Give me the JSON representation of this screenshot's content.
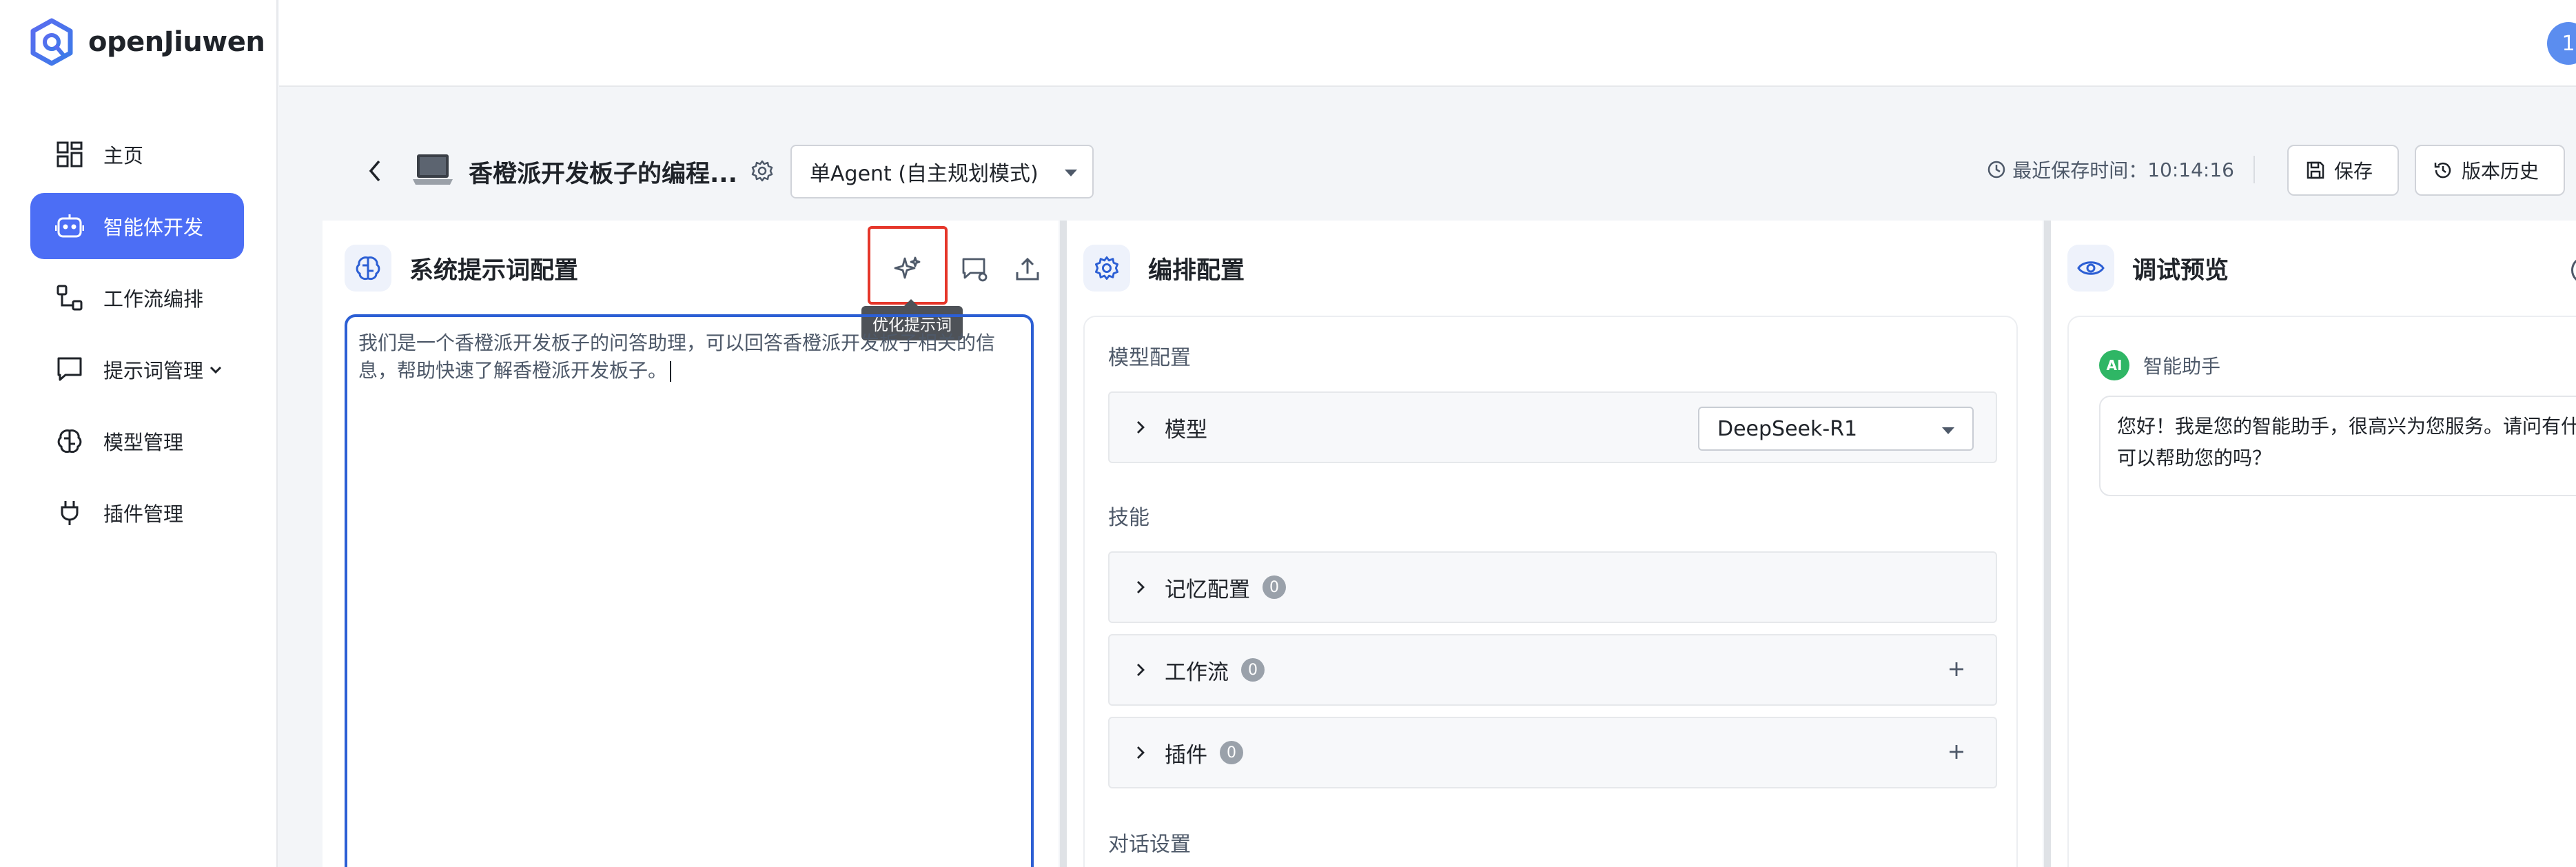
{
  "brand": {
    "name": "openJiuwen",
    "accent": "#4c6ef5"
  },
  "sidebar": {
    "items": [
      {
        "label": "主页",
        "icon": "grid-icon",
        "active": false
      },
      {
        "label": "智能体开发",
        "icon": "robot-icon",
        "active": true
      },
      {
        "label": "工作流编排",
        "icon": "workflow-icon",
        "active": false
      },
      {
        "label": "提示词管理",
        "icon": "chat-bubble-icon",
        "active": false,
        "expandable": true
      },
      {
        "label": "模型管理",
        "icon": "brain-icon",
        "active": false
      },
      {
        "label": "插件管理",
        "icon": "plug-icon",
        "active": false
      }
    ]
  },
  "user": {
    "avatar_text": "1"
  },
  "header": {
    "agent_title": "香橙派开发板子的编程...",
    "mode": "单Agent (自主规划模式)",
    "save_time_label": "最近保存时间：",
    "save_time": "10:14:16",
    "save_button": "保存",
    "history_button": "版本历史"
  },
  "prompt_panel": {
    "title": "系统提示词配置",
    "tooltip": "优化提示词",
    "prompt_text": "我们是一个香橙派开发板子的问答助理，可以回答香橙派开发板子相关的信息，帮助快速了解香橙派开发板子。"
  },
  "orchestration_panel": {
    "title": "编排配置",
    "model_section": "模型配置",
    "model_label": "模型",
    "model_value": "DeepSeek-R1",
    "skills_section": "技能",
    "skills": [
      {
        "label": "记忆配置",
        "count": "0",
        "addable": false
      },
      {
        "label": "工作流",
        "count": "0",
        "addable": true
      },
      {
        "label": "插件",
        "count": "0",
        "addable": true
      }
    ],
    "dialog_section": "对话设置"
  },
  "preview_panel": {
    "title": "调试预览",
    "bot_avatar": "AI",
    "bot_name": "智能助手",
    "greeting": "您好！我是您的智能助手，很高兴为您服务。请问有什么可以帮助您的吗？"
  }
}
